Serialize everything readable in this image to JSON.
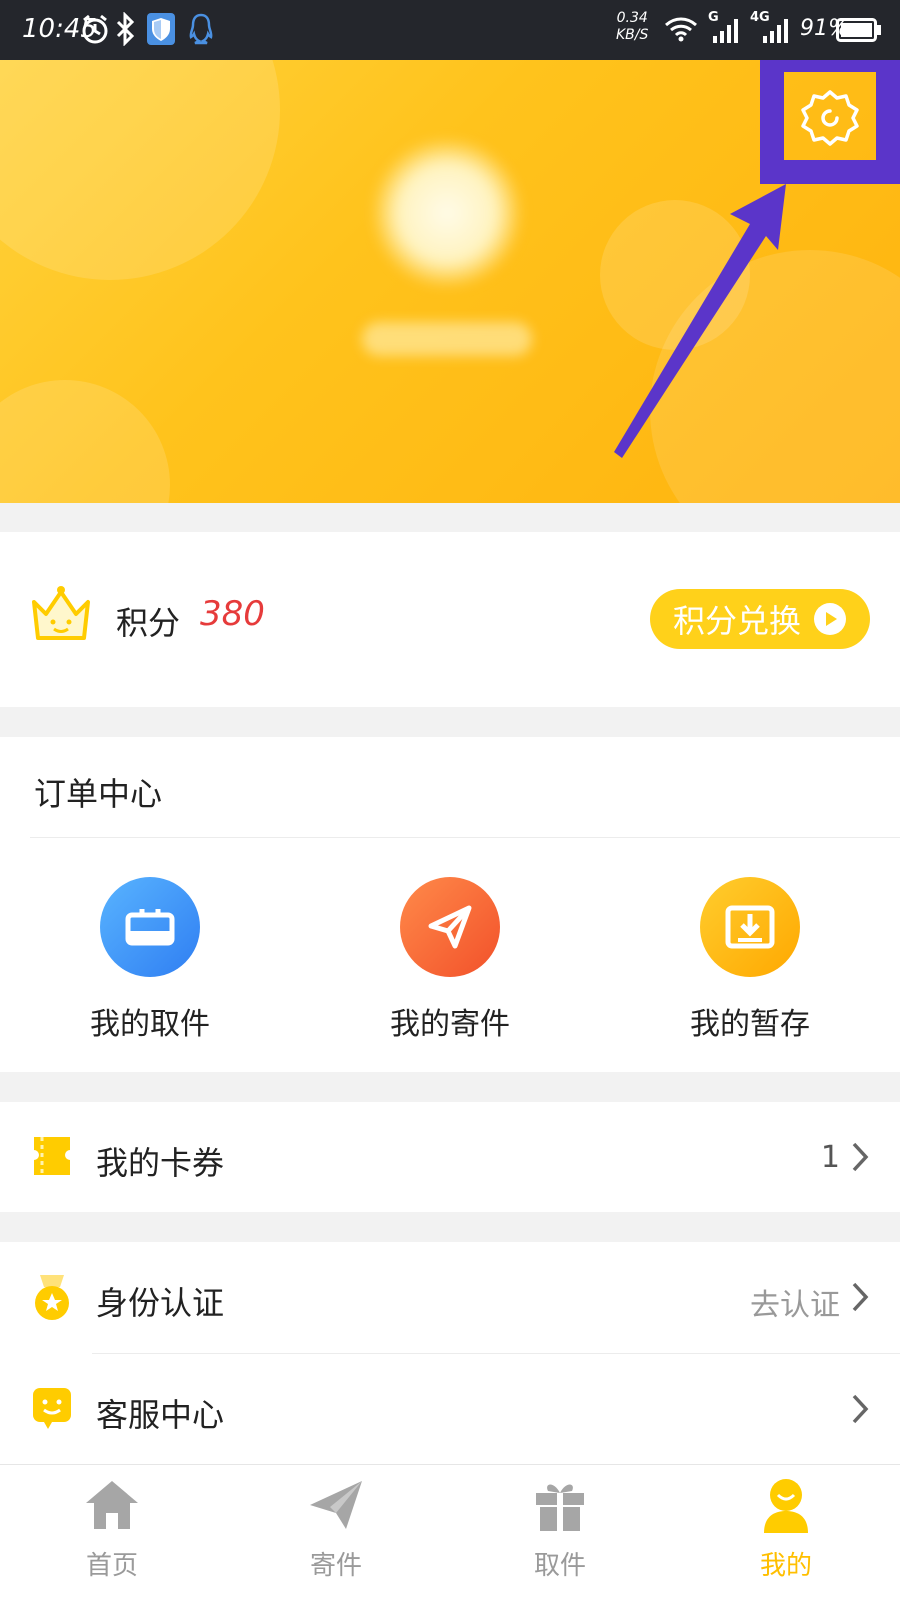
{
  "status_bar": {
    "time": "10:45",
    "net_speed_value": "0.34",
    "net_speed_unit": "KB/S",
    "signal_1_label": "G",
    "signal_2_label": "4G",
    "battery": "91%",
    "icons": [
      "alarm-icon",
      "bluetooth-icon",
      "shield-app-icon",
      "qq-icon",
      "wifi-icon",
      "signal-icon",
      "battery-icon"
    ]
  },
  "header": {
    "settings_icon": "gear-icon",
    "accent_color": "#ffc31c",
    "highlight_color": "#5b35c9"
  },
  "points": {
    "label": "积分",
    "value": "380",
    "redeem_label": "积分兑换",
    "value_color": "#e63b3b"
  },
  "orders": {
    "title": "订单中心",
    "items": [
      {
        "label": "我的取件",
        "icon": "inbox-icon",
        "color": "#3d8ef8"
      },
      {
        "label": "我的寄件",
        "icon": "paper-plane-icon",
        "color": "#ff6a3d"
      },
      {
        "label": "我的暂存",
        "icon": "storage-box-icon",
        "color": "#ffb400"
      }
    ]
  },
  "coupons": {
    "label": "我的卡券",
    "count": "1"
  },
  "identity": {
    "label": "身份认证",
    "action": "去认证"
  },
  "service": {
    "label": "客服中心"
  },
  "tabbar": {
    "tabs": [
      {
        "label": "首页",
        "icon": "home-icon"
      },
      {
        "label": "寄件",
        "icon": "paper-plane-icon"
      },
      {
        "label": "取件",
        "icon": "gift-icon"
      },
      {
        "label": "我的",
        "icon": "profile-icon",
        "active": true
      }
    ]
  }
}
